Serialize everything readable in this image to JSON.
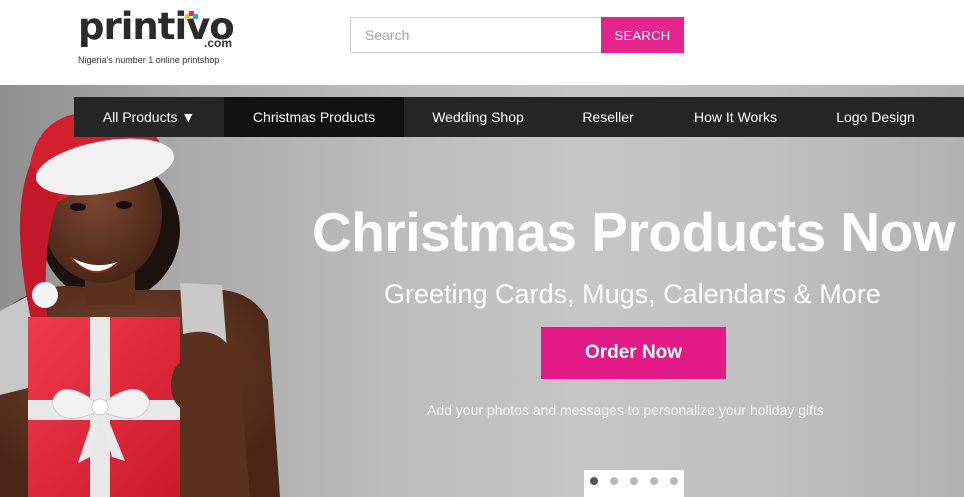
{
  "brand": {
    "name": "printivo",
    "name_part1": "print",
    "name_part2": "ivo",
    "domain_suffix": ".com",
    "tagline": "Nigeria's number 1 online printshop",
    "dot_colors": [
      "#f7c500",
      "#e5248e",
      "#1da9e1"
    ]
  },
  "search": {
    "placeholder": "Search",
    "value": "",
    "button_label": "SEARCH"
  },
  "nav": {
    "items": [
      {
        "label": "All Products ▼"
      },
      {
        "label": "Christmas Products"
      },
      {
        "label": "Wedding Shop"
      },
      {
        "label": "Reseller"
      },
      {
        "label": "How It Works"
      },
      {
        "label": "Logo Design"
      }
    ]
  },
  "hero": {
    "title": "Christmas Products Now",
    "subtitle": "Greeting Cards, Mugs, Calendars & More",
    "cta_label": "Order Now",
    "note": "Add your photos and messages to personalize your holiday gifts",
    "slide_count": 5,
    "active_slide": 1
  },
  "colors": {
    "accent": "#e5248e",
    "nav_bg": "#252525",
    "nav_active_bg": "#111111"
  }
}
